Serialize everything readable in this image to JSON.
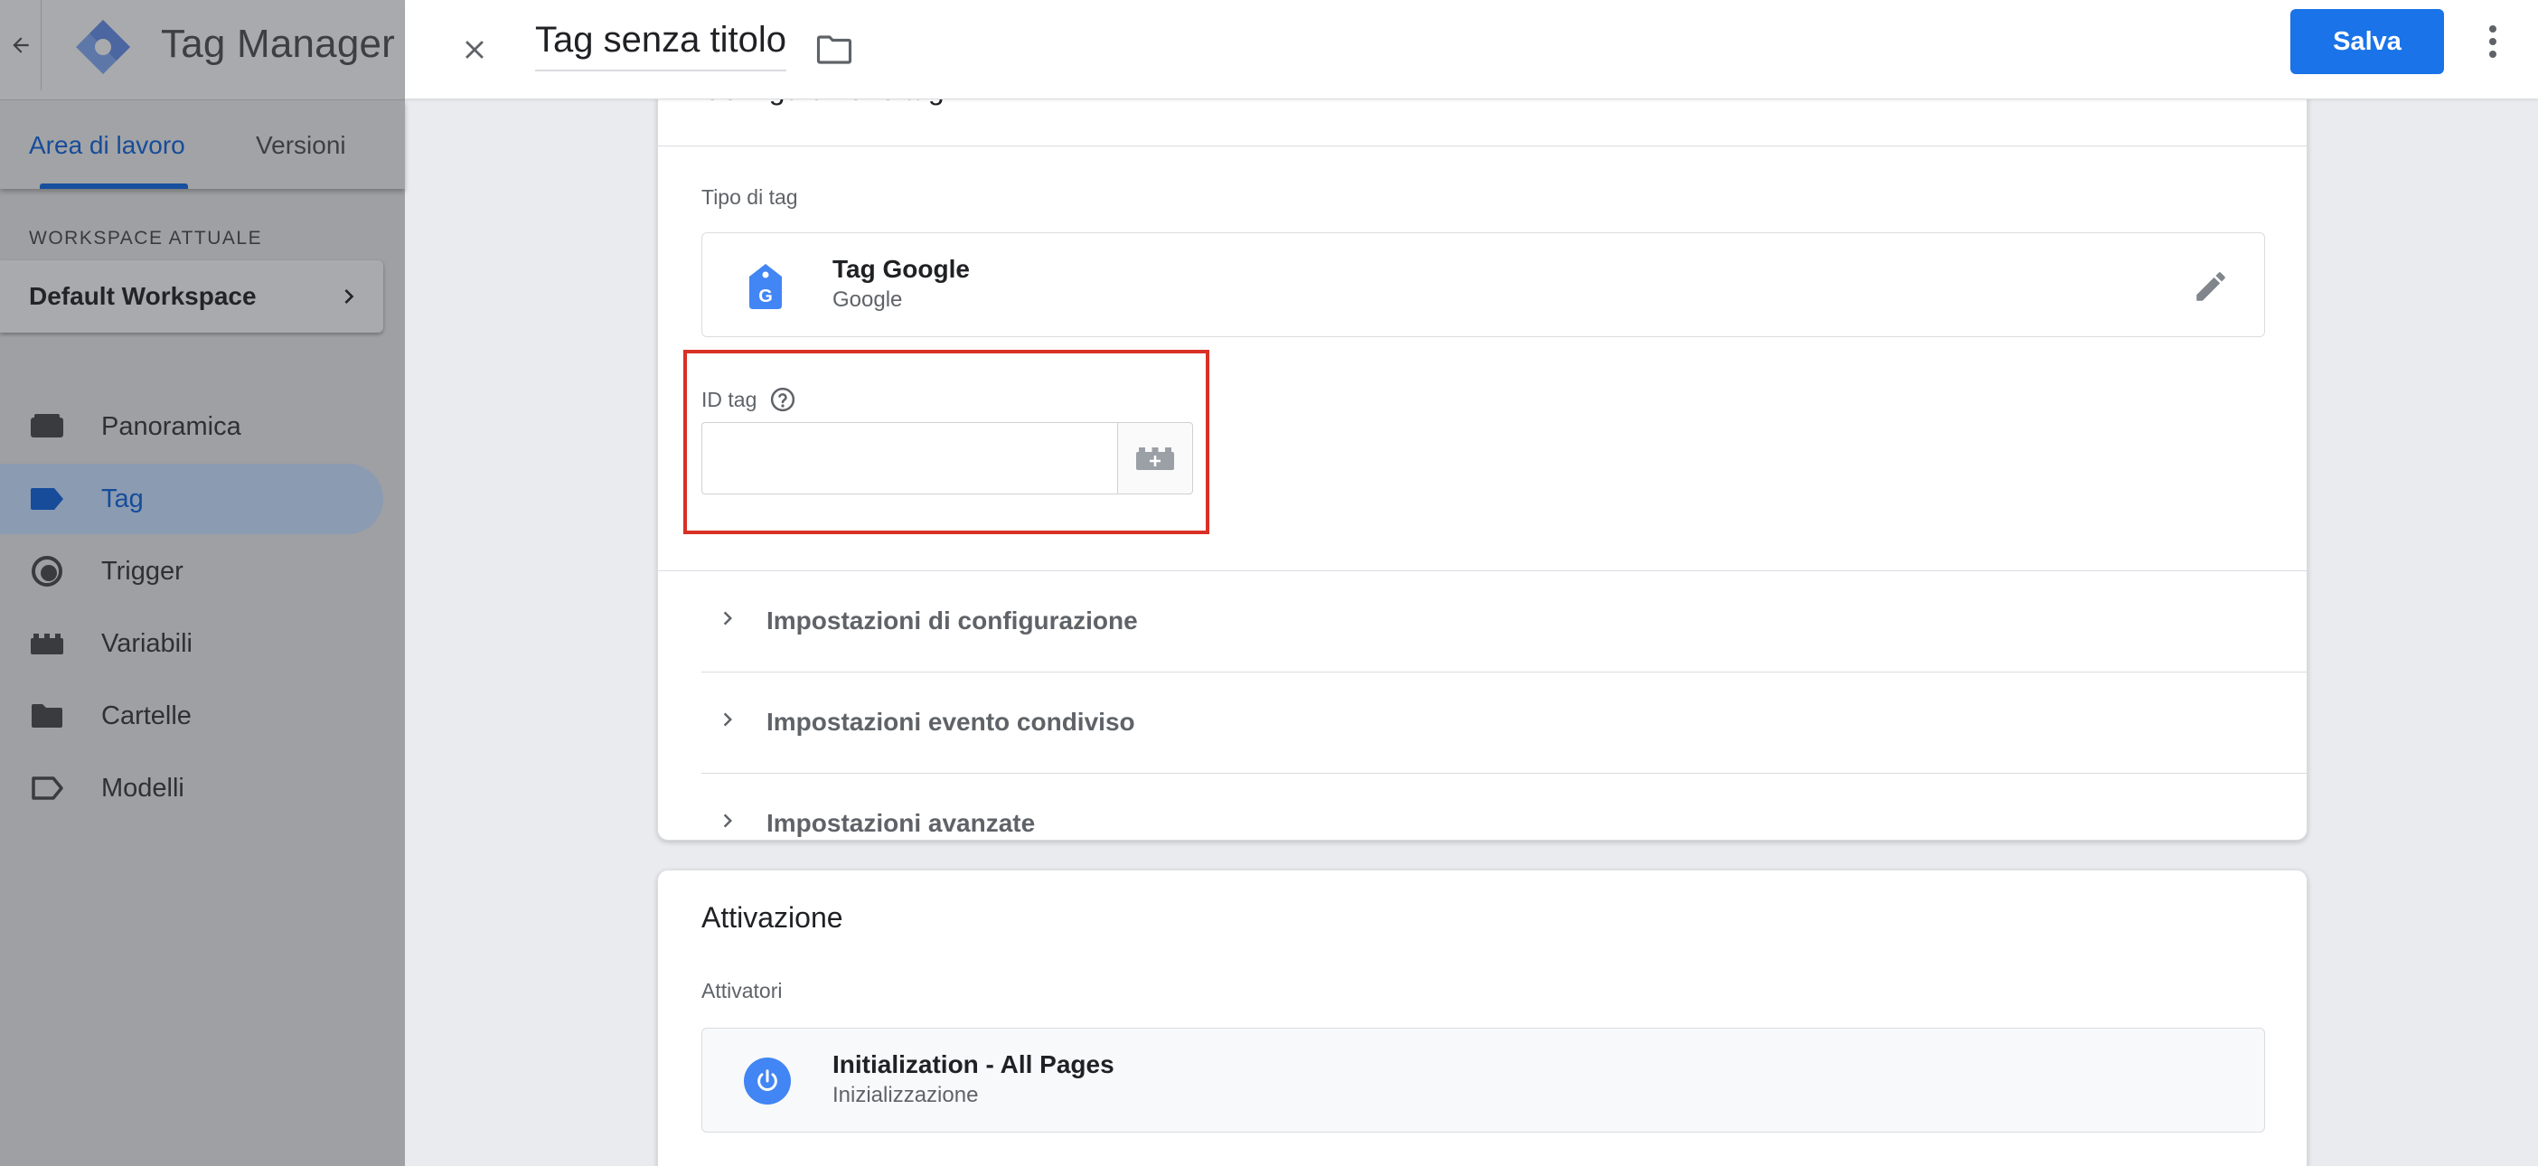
{
  "app": {
    "title": "Tag Manager"
  },
  "sidebar": {
    "tabs": [
      {
        "label": "Area di lavoro",
        "active": true
      },
      {
        "label": "Versioni",
        "active": false
      }
    ],
    "workspace_label": "WORKSPACE ATTUALE",
    "workspace_name": "Default Workspace",
    "nav": [
      {
        "label": "Panoramica",
        "icon": "overview-icon",
        "active": false
      },
      {
        "label": "Tag",
        "icon": "tag-icon",
        "active": true
      },
      {
        "label": "Trigger",
        "icon": "trigger-icon",
        "active": false
      },
      {
        "label": "Variabili",
        "icon": "variables-icon",
        "active": false
      },
      {
        "label": "Cartelle",
        "icon": "folder-icon",
        "active": false
      },
      {
        "label": "Modelli",
        "icon": "templates-icon",
        "active": false
      }
    ]
  },
  "header": {
    "tag_title": "Tag senza titolo",
    "save_label": "Salva"
  },
  "config": {
    "section_title": "Configurazione tag",
    "tag_type_label": "Tipo di tag",
    "tag_type": {
      "name": "Tag Google",
      "vendor": "Google",
      "icon": "google-tag-icon"
    },
    "id_label": "ID tag",
    "id_value": "",
    "accordions": [
      {
        "label": "Impostazioni di configurazione"
      },
      {
        "label": "Impostazioni evento condiviso"
      },
      {
        "label": "Impostazioni avanzate"
      }
    ]
  },
  "triggering": {
    "title": "Attivazione",
    "triggers_label": "Attivatori",
    "trigger": {
      "name": "Initialization - All Pages",
      "type": "Inizializzazione",
      "icon": "power-icon"
    }
  },
  "colors": {
    "accent": "#1a73e8",
    "highlight": "#d93025",
    "sidebar_dim": "#9fa0a3"
  }
}
